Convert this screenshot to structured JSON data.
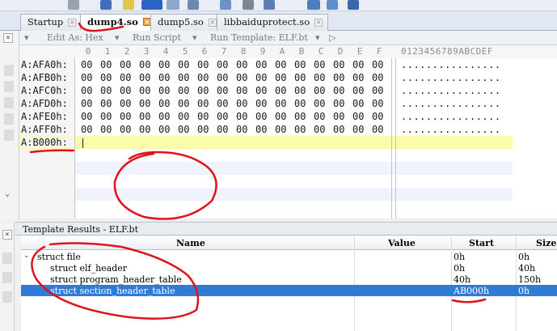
{
  "tabs": [
    {
      "label": "Startup",
      "active": false
    },
    {
      "label": "dump4.so",
      "active": true
    },
    {
      "label": "dump5.so",
      "active": false
    },
    {
      "label": "libbaiduprotect.so",
      "active": false
    }
  ],
  "editor_toolbar": {
    "edit_as": "Edit As: Hex",
    "run_script": "Run Script",
    "run_template": "Run Template: ELF.bt"
  },
  "hex": {
    "columns": [
      "0",
      "1",
      "2",
      "3",
      "4",
      "5",
      "6",
      "7",
      "8",
      "9",
      "A",
      "B",
      "C",
      "D",
      "E",
      "F"
    ],
    "ascii_header": "0123456789ABCDEF",
    "rows": [
      {
        "addr": "A:AFA0h:",
        "bytes": [
          "00",
          "00",
          "00",
          "00",
          "00",
          "00",
          "00",
          "00",
          "00",
          "00",
          "00",
          "00",
          "00",
          "00",
          "00",
          "00"
        ],
        "ascii": "................"
      },
      {
        "addr": "A:AFB0h:",
        "bytes": [
          "00",
          "00",
          "00",
          "00",
          "00",
          "00",
          "00",
          "00",
          "00",
          "00",
          "00",
          "00",
          "00",
          "00",
          "00",
          "00"
        ],
        "ascii": "................"
      },
      {
        "addr": "A:AFC0h:",
        "bytes": [
          "00",
          "00",
          "00",
          "00",
          "00",
          "00",
          "00",
          "00",
          "00",
          "00",
          "00",
          "00",
          "00",
          "00",
          "00",
          "00"
        ],
        "ascii": "................"
      },
      {
        "addr": "A:AFD0h:",
        "bytes": [
          "00",
          "00",
          "00",
          "00",
          "00",
          "00",
          "00",
          "00",
          "00",
          "00",
          "00",
          "00",
          "00",
          "00",
          "00",
          "00"
        ],
        "ascii": "................"
      },
      {
        "addr": "A:AFE0h:",
        "bytes": [
          "00",
          "00",
          "00",
          "00",
          "00",
          "00",
          "00",
          "00",
          "00",
          "00",
          "00",
          "00",
          "00",
          "00",
          "00",
          "00"
        ],
        "ascii": "................"
      },
      {
        "addr": "A:AFF0h:",
        "bytes": [
          "00",
          "00",
          "00",
          "00",
          "00",
          "00",
          "00",
          "00",
          "00",
          "00",
          "00",
          "00",
          "00",
          "00",
          "00",
          "00"
        ],
        "ascii": "................"
      }
    ],
    "cursor_row": {
      "addr": "A:B000h:"
    }
  },
  "template_results": {
    "title": "Template Results - ELF.bt",
    "headers": {
      "name": "Name",
      "value": "Value",
      "start": "Start",
      "size": "Size"
    },
    "rows": [
      {
        "name": "struct file",
        "value": "",
        "start": "0h",
        "size": "0h",
        "indent": 0,
        "expandable": true,
        "selected": false
      },
      {
        "name": "struct elf_header",
        "value": "",
        "start": "0h",
        "size": "40h",
        "indent": 1,
        "expandable": false,
        "selected": false
      },
      {
        "name": "struct program_header_table",
        "value": "",
        "start": "40h",
        "size": "150h",
        "indent": 1,
        "expandable": false,
        "selected": false
      },
      {
        "name": "struct section_header_table",
        "value": "",
        "start": "AB000h",
        "size": "0h",
        "indent": 1,
        "expandable": false,
        "selected": true
      }
    ]
  },
  "colors": {
    "selection": "#2f7bd6",
    "cursor_row": "#fbfba9",
    "annotation": "#e0121b"
  }
}
